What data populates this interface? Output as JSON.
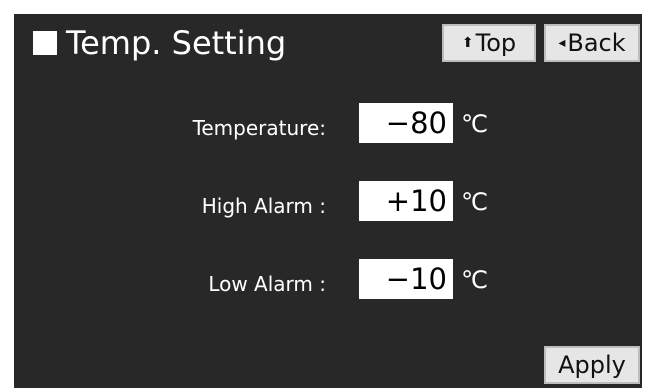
{
  "header": {
    "title": "Temp. Setting",
    "title_icon": "white-square-icon"
  },
  "nav": {
    "top": {
      "icon": "up-arrow-icon",
      "glyph": "⬆",
      "label": "Top"
    },
    "back": {
      "icon": "left-triangle-icon",
      "glyph": "◂",
      "label": "Back"
    }
  },
  "settings": [
    {
      "label": "Temperature:",
      "value": "−80",
      "unit": "℃"
    },
    {
      "label": "High Alarm  :",
      "value": "+10",
      "unit": "℃"
    },
    {
      "label": "Low Alarm  :",
      "value": "−10",
      "unit": "℃"
    }
  ],
  "footer": {
    "apply_label": "Apply"
  },
  "colors": {
    "background": "#282828",
    "button_face": "#e6e6e6",
    "text": "#ffffff"
  }
}
